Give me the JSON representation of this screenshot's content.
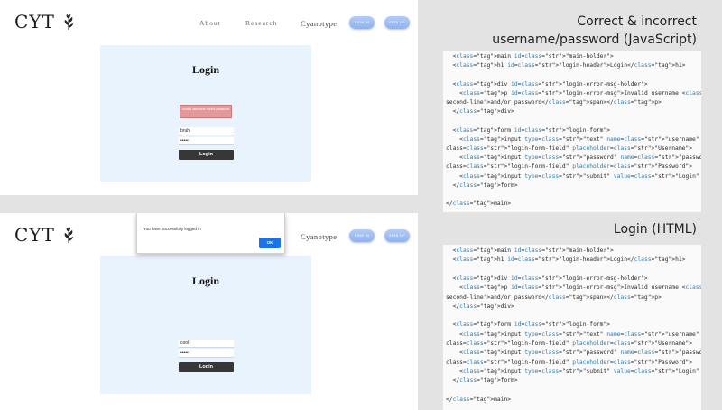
{
  "site": {
    "logo": "CYT",
    "nav": [
      "About",
      "Research",
      "Cyanotype"
    ],
    "pills": [
      "SIGN IN",
      "SIGN UP"
    ]
  },
  "top_shot": {
    "login_title": "Login",
    "error_message": "Invalid username and/or password",
    "username_value": "bruh",
    "password_value": "•••••",
    "submit_label": "Login"
  },
  "bottom_shot": {
    "alert_message": "You have successfully logged in",
    "alert_ok": "OK",
    "login_title": "Login",
    "username_value": "cool",
    "password_value": "•••••",
    "submit_label": "Login"
  },
  "captions": {
    "top_line1": "Correct & incorrect",
    "top_line2": "username/password (JavaScript)",
    "bottom": "Login (HTML)"
  },
  "code_top": [
    "  <main id=\"main-holder\">",
    "  <h1 id=\"login-header\">Login</h1>",
    "",
    "  <div id=\"login-error-msg-holder\">",
    "    <p id=\"login-error-msg\">Invalid username <span id=\"error-msg-",
    "second-line\">and/or password</span></p>",
    "  </div>",
    "",
    "  <form id=\"login-form\">",
    "    <input type=\"text\" name=\"username\" id=\"username-field\"",
    "class=\"login-form-field\" placeholder=\"Username\">",
    "    <input type=\"password\" name=\"password\" id=\"password-field\"",
    "class=\"login-form-field\" placeholder=\"Password\">",
    "    <input type=\"submit\" value=\"Login\" id=\"login-form-submit\">",
    "  </form>",
    "",
    "</main>"
  ],
  "code_bottom": [
    "  <main id=\"main-holder\">",
    "  <h1 id=\"login-header\">Login</h1>",
    "",
    "  <div id=\"login-error-msg-holder\">",
    "    <p id=\"login-error-msg\">Invalid username <span id=\"error-msg-",
    "second-line\">and/or password</span></p>",
    "  </div>",
    "",
    "  <form id=\"login-form\">",
    "    <input type=\"text\" name=\"username\" id=\"username-field\"",
    "class=\"login-form-field\" placeholder=\"Username\">",
    "    <input type=\"password\" name=\"password\" id=\"password-field\"",
    "class=\"login-form-field\" placeholder=\"Password\">",
    "    <input type=\"submit\" value=\"Login\" id=\"login-form-submit\">",
    "  </form>",
    "",
    "</main>"
  ],
  "colors": {
    "panel": "#e9f3fe",
    "error": "#e5989a",
    "button": "#373737",
    "pill": "#9fbff2",
    "alert_ok": "#1a73e8"
  }
}
